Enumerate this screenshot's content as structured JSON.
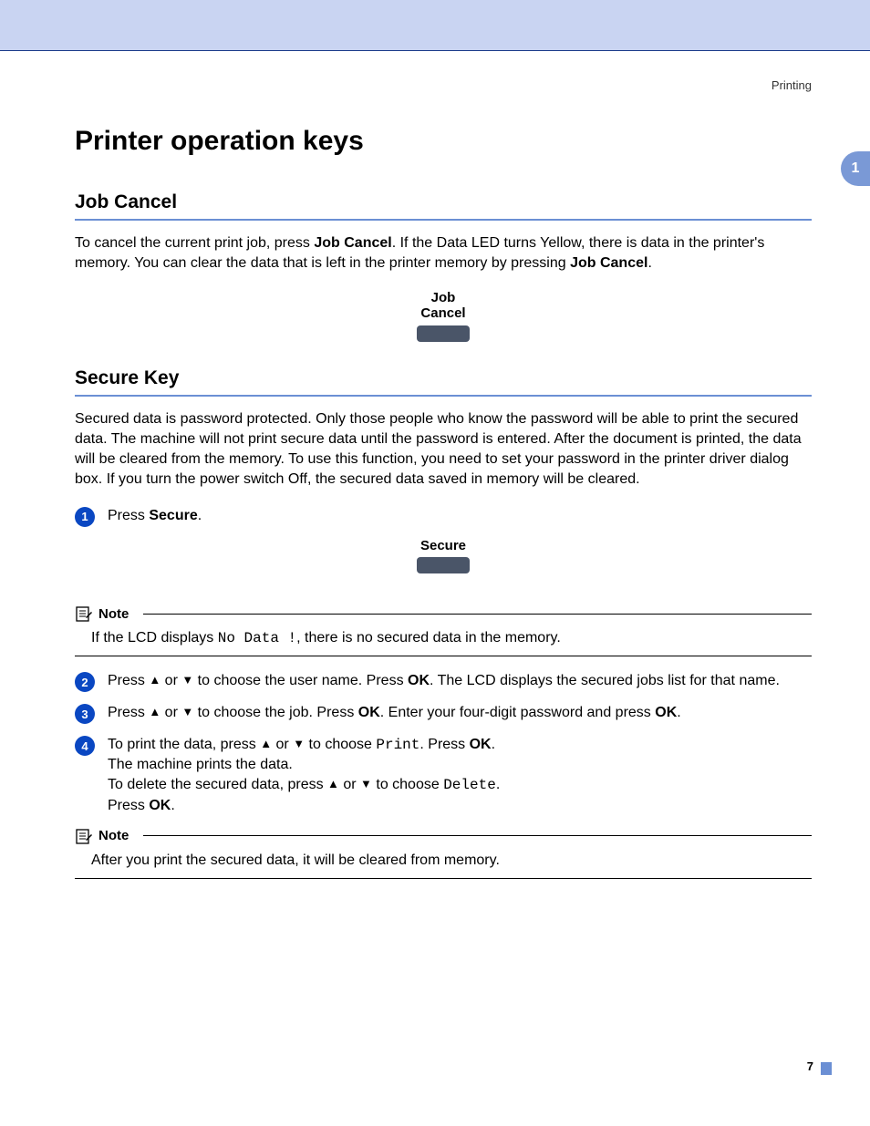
{
  "header": {
    "section": "Printing"
  },
  "sideTab": "1",
  "title": "Printer operation keys",
  "jobCancel": {
    "heading": "Job Cancel",
    "p1a": "To cancel the current print job, press ",
    "p1b": "Job Cancel",
    "p1c": ". If the Data LED turns Yellow, there is data in the printer's memory. You can clear the data that is left in the printer memory by pressing ",
    "p1d": "Job Cancel",
    "p1e": ".",
    "keyLabel1": "Job",
    "keyLabel2": "Cancel"
  },
  "secureKey": {
    "heading": "Secure Key",
    "intro": "Secured data is password protected. Only those people who know the password will be able to print the secured data. The machine will not print secure data until the password is entered. After the document is printed, the data will be cleared from the memory. To use this function, you need to set your password in the printer driver dialog box. If you turn the power switch Off, the secured data saved in memory will be cleared.",
    "step1a": "Press ",
    "step1b": "Secure",
    "step1c": ".",
    "keyLabel": "Secure",
    "note1Title": "Note",
    "note1a": "If the LCD displays ",
    "note1b": "No Data !",
    "note1c": ", there is no secured data in the memory.",
    "step2a": "Press ",
    "step2b": " or ",
    "step2c": " to choose the user name. Press ",
    "step2d": "OK",
    "step2e": ". The LCD displays the secured jobs list for that name.",
    "step3a": "Press ",
    "step3b": " or ",
    "step3c": " to choose the job. Press ",
    "step3d": "OK",
    "step3e": ". Enter your four-digit password and press ",
    "step3f": "OK",
    "step3g": ".",
    "step4a": "To print the data, press ",
    "step4b": " or ",
    "step4c": " to choose ",
    "step4d": "Print",
    "step4e": ". Press ",
    "step4f": "OK",
    "step4g": ".",
    "step4h": "The machine prints the data.",
    "step4i": "To delete the secured data, press ",
    "step4j": " or ",
    "step4k": " to choose ",
    "step4l": "Delete",
    "step4m": ".",
    "step4n": "Press ",
    "step4o": "OK",
    "step4p": ".",
    "note2Title": "Note",
    "note2": "After you print the secured data, it will be cleared from memory."
  },
  "arrows": {
    "up": "▲",
    "down": "▼"
  },
  "pageNumber": "7"
}
